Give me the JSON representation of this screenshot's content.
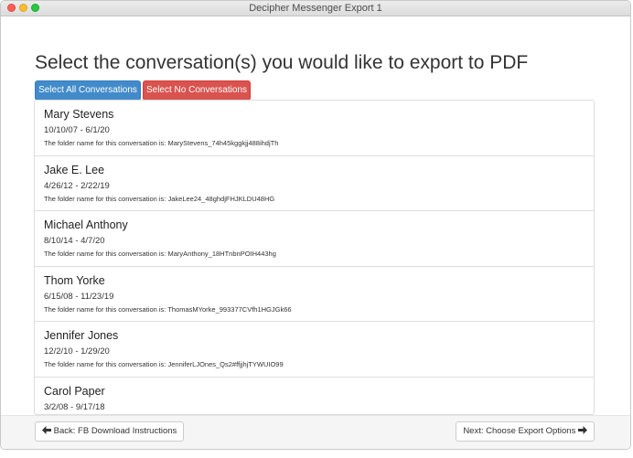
{
  "window": {
    "title": "Decipher Messenger Export 1"
  },
  "page": {
    "heading": "Select the conversation(s) you would like to export to PDF"
  },
  "actions": {
    "select_all_label": "Select All Conversations",
    "select_none_label": "Select No Conversations"
  },
  "conversations": [
    {
      "name": "Mary Stevens",
      "dates": "10/10/07 - 6/1/20",
      "folder_text": "The folder name for this conversation is: MaryStevens_74h45kggkjj488ihdjTh"
    },
    {
      "name": "Jake E. Lee",
      "dates": "4/26/12 - 2/22/19",
      "folder_text": "The folder name for this conversation is: JakeLee24_48ghdjFHJKLDU48HG"
    },
    {
      "name": "Michael Anthony",
      "dates": "8/10/14 - 4/7/20",
      "folder_text": "The folder name for this conversation is: MaryAnthony_18HTnbnPOIH443hg"
    },
    {
      "name": "Thom Yorke",
      "dates": "6/15/08 - 11/23/19",
      "folder_text": "The folder name for this conversation is: ThomasMYorke_993377CVfh1HGJGk66"
    },
    {
      "name": "Jennifer Jones",
      "dates": "12/2/10 - 1/29/20",
      "folder_text": "The folder name for this conversation is: JenniferLJOnes_Qs2#ffjjhjTYWUIO99"
    },
    {
      "name": "Carol Paper",
      "dates": "3/2/08 - 9/17/18",
      "folder_text": ""
    }
  ],
  "footer": {
    "back_label": "Back: FB Download Instructions",
    "next_label": "Next: Choose Export Options",
    "back_icon": "arrow-left-icon",
    "next_icon": "arrow-right-icon"
  },
  "colors": {
    "primary": "#428bca",
    "danger": "#d9534f"
  }
}
